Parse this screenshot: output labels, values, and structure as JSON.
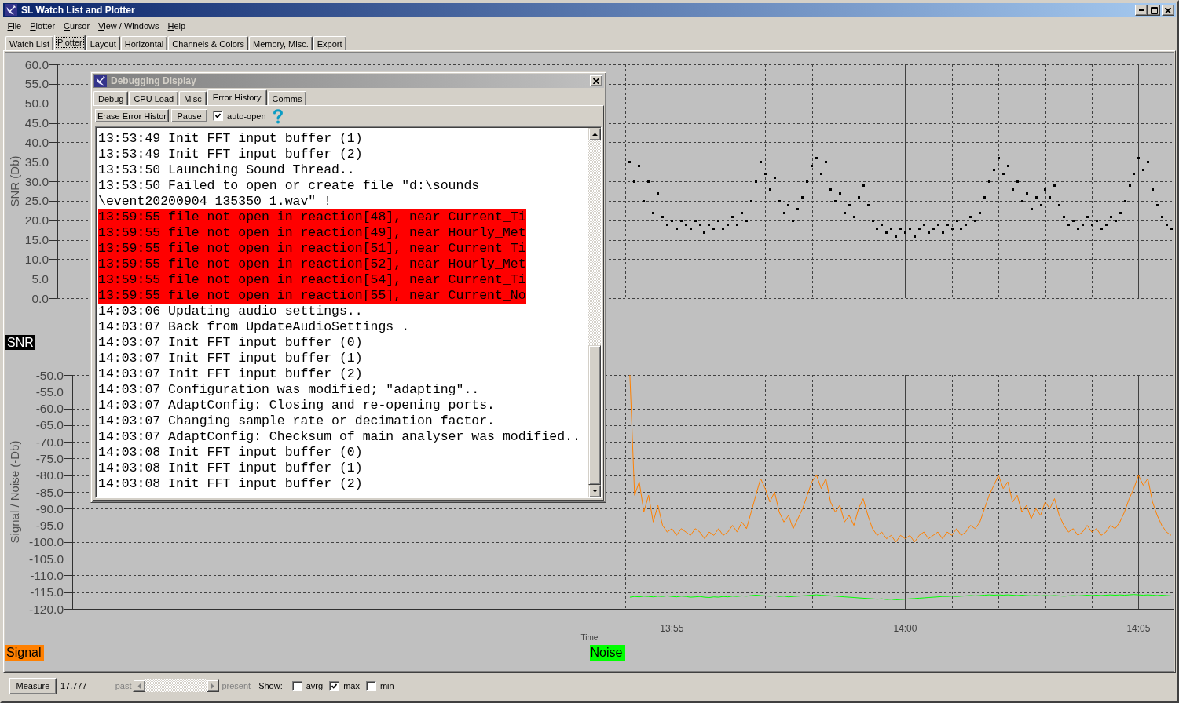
{
  "window": {
    "title": "SL Watch List and Plotter"
  },
  "menu": [
    "File",
    "Plotter",
    "Cursor",
    "View / Windows",
    "Help"
  ],
  "tabs": [
    {
      "label": "Watch List",
      "selected": false
    },
    {
      "label": "Plotter",
      "selected": true
    },
    {
      "label": "Layout",
      "selected": false
    },
    {
      "label": "Horizontal",
      "selected": false
    },
    {
      "label": "Channels & Colors",
      "selected": false
    },
    {
      "label": "Memory, Misc.",
      "selected": false
    },
    {
      "label": "Export",
      "selected": false
    }
  ],
  "plotter": {
    "upper_chart": {
      "chart_data": {
        "type": "scatter",
        "ylabel": "SNR (Db)",
        "grid": true,
        "categories": [
          null,
          null,
          null,
          null,
          null,
          null,
          null,
          null,
          null,
          null,
          null,
          null,
          null,
          null,
          null,
          null,
          null,
          null,
          null,
          null,
          null,
          null,
          null,
          null,
          null,
          null,
          null,
          null,
          null,
          null,
          null,
          null,
          null,
          null,
          null,
          null,
          null,
          null,
          null,
          null,
          null,
          null,
          null,
          null,
          null,
          null,
          null,
          null,
          null,
          null,
          null,
          null,
          null,
          null,
          null,
          null,
          null,
          null,
          null,
          null,
          null,
          null,
          null,
          null,
          null,
          null,
          null,
          null,
          null,
          null,
          null,
          null,
          null,
          null,
          null,
          null,
          null,
          null,
          null,
          null,
          null,
          null,
          null,
          null,
          null,
          null,
          null,
          null,
          null,
          null,
          null,
          null,
          null,
          null,
          null,
          null,
          null,
          null,
          null,
          null,
          null,
          null,
          null,
          null,
          null,
          null,
          null,
          null,
          null,
          null,
          null,
          null,
          null,
          null,
          null,
          null,
          null,
          null,
          null,
          null,
          null,
          null,
          null,
          null,
          null,
          null,
          null,
          null,
          null,
          null,
          null,
          null,
          null,
          null,
          null,
          null,
          null,
          null,
          null,
          null,
          null,
          null,
          null,
          null,
          null,
          null,
          null,
          null,
          null,
          null,
          null,
          null,
          null,
          null,
          null,
          null,
          null,
          null,
          null,
          null,
          null,
          null,
          null,
          null,
          null,
          null,
          null,
          null,
          null,
          null,
          null,
          null,
          null,
          null,
          null,
          null,
          null,
          null,
          null,
          null,
          null,
          null,
          null,
          null,
          null,
          null,
          null,
          null,
          null,
          null,
          null,
          null,
          null,
          null,
          null,
          null,
          null,
          null,
          null,
          null,
          null,
          null,
          null,
          null,
          null,
          null,
          null,
          null,
          null,
          null,
          null,
          null,
          null,
          null,
          null,
          null,
          null,
          null,
          null,
          null,
          null,
          null,
          null,
          null,
          null,
          null,
          null,
          null,
          null,
          null,
          null,
          null,
          null,
          null,
          null,
          null,
          null,
          null,
          null
        ],
        "ylim": [
          0,
          60
        ],
        "yticks": [
          {
            "value": 60,
            "label": "60.0"
          },
          {
            "value": 55,
            "label": "55.0"
          },
          {
            "value": 50,
            "label": "50.0"
          },
          {
            "value": 45,
            "label": "45.0"
          },
          {
            "value": 40,
            "label": "40.0"
          },
          {
            "value": 35,
            "label": "35.0"
          },
          {
            "value": 30,
            "label": "30.0"
          },
          {
            "value": 25,
            "label": "25.0"
          },
          {
            "value": 20,
            "label": "20.0"
          },
          {
            "value": 15,
            "label": "15.0"
          },
          {
            "value": 10,
            "label": "10.0"
          },
          {
            "value": 5,
            "label": "5.0"
          },
          {
            "value": 0,
            "label": "0.0"
          }
        ],
        "series": [
          {
            "name": "SNR",
            "color": "#000000",
            "values": [
              null,
              null,
              null,
              null,
              null,
              null,
              null,
              null,
              null,
              null,
              null,
              null,
              null,
              null,
              null,
              null,
              null,
              null,
              null,
              null,
              null,
              null,
              null,
              null,
              null,
              null,
              null,
              null,
              null,
              null,
              null,
              null,
              null,
              null,
              null,
              null,
              null,
              null,
              null,
              null,
              null,
              null,
              null,
              null,
              null,
              null,
              null,
              null,
              null,
              null,
              null,
              null,
              null,
              null,
              null,
              null,
              null,
              null,
              null,
              null,
              null,
              null,
              null,
              null,
              null,
              null,
              null,
              null,
              null,
              null,
              null,
              null,
              null,
              null,
              null,
              null,
              null,
              null,
              null,
              null,
              null,
              null,
              null,
              null,
              null,
              null,
              null,
              null,
              null,
              null,
              null,
              null,
              null,
              null,
              null,
              null,
              null,
              null,
              null,
              null,
              null,
              null,
              null,
              null,
              null,
              null,
              null,
              null,
              null,
              null,
              null,
              null,
              null,
              null,
              null,
              null,
              null,
              null,
              null,
              null,
              null,
              null,
              35,
              30,
              34,
              25,
              30,
              22,
              27,
              21,
              19,
              20,
              18,
              20,
              19,
              18,
              20,
              19,
              17,
              19,
              18,
              20,
              18,
              19,
              21,
              19,
              22,
              20,
              25,
              30,
              35,
              32,
              28,
              31,
              25,
              22,
              24,
              20,
              23,
              26,
              30,
              34,
              36,
              32,
              35,
              28,
              25,
              27,
              22,
              24,
              21,
              26,
              29,
              24,
              20,
              18,
              19,
              17,
              18,
              16,
              18,
              17,
              18,
              16,
              18,
              19,
              17,
              18,
              19,
              17,
              19,
              18,
              20,
              18,
              19,
              21,
              20,
              22,
              26,
              30,
              33,
              36,
              32,
              34,
              28,
              30,
              25,
              27,
              23,
              26,
              24,
              28,
              26,
              29,
              24,
              21,
              19,
              20,
              18,
              19,
              21,
              19,
              20,
              18,
              19,
              21,
              20,
              22,
              25,
              29,
              32,
              36,
              33,
              35,
              28,
              24,
              21,
              19,
              18
            ]
          }
        ]
      }
    },
    "lower_chart": {
      "chart_data": {
        "type": "line",
        "xlabel": "Time",
        "ylabel": "Signal / Noise (-Db)",
        "grid": true,
        "categories": [
          null,
          null,
          null,
          null,
          null,
          null,
          null,
          null,
          null,
          null,
          null,
          null,
          null,
          null,
          null,
          null,
          null,
          null,
          null,
          null,
          null,
          null,
          null,
          null,
          null,
          null,
          null,
          null,
          null,
          null,
          null,
          null,
          null,
          null,
          null,
          null,
          null,
          null,
          null,
          null,
          null,
          null,
          null,
          null,
          null,
          null,
          null,
          null,
          null,
          null,
          null,
          null,
          null,
          null,
          null,
          null,
          null,
          null,
          null,
          null,
          null,
          null,
          null,
          null,
          null,
          null,
          null,
          null,
          null,
          null,
          null,
          null,
          null,
          null,
          null,
          null,
          null,
          null,
          null,
          null,
          null,
          null,
          null,
          null,
          null,
          null,
          null,
          null,
          null,
          null,
          null,
          null,
          null,
          null,
          null,
          null,
          null,
          null,
          null,
          null,
          null,
          null,
          null,
          null,
          null,
          null,
          null,
          null,
          null,
          null,
          null,
          null,
          null,
          null,
          null,
          null,
          null,
          null,
          null,
          null,
          null,
          null,
          null,
          null,
          null,
          null,
          null,
          null,
          "13:55",
          null,
          null,
          null,
          null,
          null,
          null,
          null,
          null,
          null,
          null,
          null,
          null,
          null,
          null,
          null,
          null,
          null,
          null,
          null,
          null,
          null,
          null,
          null,
          null,
          null,
          null,
          null,
          null,
          null,
          null,
          null,
          null,
          null,
          null,
          null,
          null,
          null,
          null,
          null,
          null,
          null,
          null,
          null,
          null,
          null,
          null,
          null,
          null,
          null,
          "14:00",
          null,
          null,
          null,
          null,
          null,
          null,
          null,
          null,
          null,
          null,
          null,
          null,
          null,
          null,
          null,
          null,
          null,
          null,
          null,
          null,
          null,
          null,
          null,
          null,
          null,
          null,
          null,
          null,
          null,
          null,
          null,
          null,
          null,
          null,
          null,
          null,
          null,
          null,
          null,
          null,
          null,
          null,
          null,
          null,
          null,
          null,
          null,
          null,
          null,
          "14:05",
          null,
          null,
          null,
          null,
          null,
          null,
          null
        ],
        "ylim": [
          -120,
          -50
        ],
        "yticks": [
          {
            "value": -50,
            "label": "-50.0"
          },
          {
            "value": -55,
            "label": "-55.0"
          },
          {
            "value": -60,
            "label": "-60.0"
          },
          {
            "value": -65,
            "label": "-65.0"
          },
          {
            "value": -70,
            "label": "-70.0"
          },
          {
            "value": -75,
            "label": "-75.0"
          },
          {
            "value": -80,
            "label": "-80.0"
          },
          {
            "value": -85,
            "label": "-85.0"
          },
          {
            "value": -90,
            "label": "-90.0"
          },
          {
            "value": -95,
            "label": "-95.0"
          },
          {
            "value": -100,
            "label": "-100.0"
          },
          {
            "value": -105,
            "label": "-105.0"
          },
          {
            "value": -110,
            "label": "-110.0"
          },
          {
            "value": -115,
            "label": "-115.0"
          },
          {
            "value": -120,
            "label": "-120.0"
          }
        ],
        "series": [
          {
            "name": "Signal",
            "color": "#ff8000",
            "values": [
              null,
              null,
              null,
              null,
              null,
              null,
              null,
              null,
              null,
              null,
              null,
              null,
              null,
              null,
              null,
              null,
              null,
              null,
              null,
              null,
              null,
              null,
              null,
              null,
              null,
              null,
              null,
              null,
              null,
              null,
              null,
              null,
              null,
              null,
              null,
              null,
              null,
              null,
              null,
              null,
              null,
              null,
              null,
              null,
              null,
              null,
              null,
              null,
              null,
              null,
              null,
              null,
              null,
              null,
              null,
              null,
              null,
              null,
              null,
              null,
              null,
              null,
              null,
              null,
              null,
              null,
              null,
              null,
              null,
              null,
              null,
              null,
              null,
              null,
              null,
              null,
              null,
              null,
              null,
              null,
              null,
              null,
              null,
              null,
              null,
              null,
              null,
              null,
              null,
              null,
              null,
              null,
              null,
              null,
              null,
              null,
              null,
              null,
              null,
              null,
              null,
              null,
              null,
              null,
              null,
              null,
              null,
              null,
              null,
              null,
              null,
              null,
              null,
              null,
              null,
              null,
              null,
              null,
              null,
              -50,
              -86,
              -82,
              -91,
              -86,
              -94,
              -89,
              -95,
              -97,
              -96,
              -98,
              -96,
              -97,
              -98,
              -96,
              -97,
              -99,
              -97,
              -98,
              -96,
              -98,
              -97,
              -95,
              -97,
              -94,
              -96,
              -91,
              -86,
              -81,
              -84,
              -88,
              -85,
              -91,
              -94,
              -92,
              -96,
              -93,
              -90,
              -86,
              -82,
              -80,
              -84,
              -81,
              -88,
              -91,
              -89,
              -94,
              -92,
              -95,
              -90,
              -87,
              -92,
              -96,
              -98,
              -97,
              -99,
              -98,
              -100,
              -98,
              -99,
              -98,
              -100,
              -98,
              -97,
              -99,
              -98,
              -97,
              -99,
              -97,
              -98,
              -96,
              -98,
              -97,
              -95,
              -96,
              -94,
              -90,
              -86,
              -83,
              -80,
              -84,
              -82,
              -88,
              -86,
              -91,
              -89,
              -93,
              -90,
              -92,
              -88,
              -90,
              -87,
              -92,
              -95,
              -97,
              -96,
              -98,
              -97,
              -95,
              -97,
              -96,
              -98,
              -97,
              -95,
              -96,
              -94,
              -91,
              -87,
              -84,
              -80,
              -83,
              -81,
              -88,
              -92,
              -95,
              -97,
              -98
            ]
          },
          {
            "name": "Noise",
            "color": "#00ff00",
            "values": [
              null,
              null,
              null,
              null,
              null,
              null,
              null,
              null,
              null,
              null,
              null,
              null,
              null,
              null,
              null,
              null,
              null,
              null,
              null,
              null,
              null,
              null,
              null,
              null,
              null,
              null,
              null,
              null,
              null,
              null,
              null,
              null,
              null,
              null,
              null,
              null,
              null,
              null,
              null,
              null,
              null,
              null,
              null,
              null,
              null,
              null,
              null,
              null,
              null,
              null,
              null,
              null,
              null,
              null,
              null,
              null,
              null,
              null,
              null,
              null,
              null,
              null,
              null,
              null,
              null,
              null,
              null,
              null,
              null,
              null,
              null,
              null,
              null,
              null,
              null,
              null,
              null,
              null,
              null,
              null,
              null,
              null,
              null,
              null,
              null,
              null,
              null,
              null,
              null,
              null,
              null,
              null,
              null,
              null,
              null,
              null,
              null,
              null,
              null,
              null,
              null,
              null,
              null,
              null,
              null,
              null,
              null,
              null,
              null,
              null,
              null,
              null,
              null,
              null,
              null,
              null,
              null,
              null,
              null,
              -116.5,
              -116.3,
              -116.4,
              -116.2,
              -116.3,
              -116.4,
              -116.2,
              -116.3,
              -116.1,
              -116.3,
              -116.4,
              -116.2,
              -116.3,
              -116.5,
              -116.4,
              -116.3,
              -116.5,
              -116.6,
              -116.4,
              -116.5,
              -116.3,
              -116.4,
              -116.2,
              -116.3,
              -116.1,
              -116.2,
              -116.0,
              -115.9,
              -116.0,
              -116.1,
              -116.2,
              -116.1,
              -116.3,
              -116.2,
              -116.4,
              -116.3,
              -116.2,
              -116.1,
              -116.0,
              -115.9,
              -115.8,
              -115.9,
              -116.0,
              -116.1,
              -116.2,
              -116.3,
              -116.4,
              -116.5,
              -116.6,
              -116.7,
              -116.8,
              -116.9,
              -117.0,
              -117.1,
              -117.0,
              -117.2,
              -117.1,
              -117.3,
              -117.2,
              -117.1,
              -117.0,
              -116.9,
              -116.8,
              -116.7,
              -116.6,
              -116.5,
              -116.4,
              -116.3,
              -116.3,
              -116.2,
              -116.3,
              -116.2,
              -116.1,
              -116.0,
              -116.1,
              -116.0,
              -115.9,
              -115.8,
              -115.9,
              -115.8,
              -115.9,
              -115.8,
              -115.9,
              -116.0,
              -115.9,
              -116.0,
              -116.1,
              -116.0,
              -116.1,
              -116.0,
              -116.1,
              -116.0,
              -116.1,
              -116.2,
              -116.1,
              -116.0,
              -116.1,
              -116.0,
              -115.9,
              -116.0,
              -115.9,
              -116.0,
              -115.9,
              -115.8,
              -115.9,
              -115.8,
              -115.9,
              -115.8,
              -115.7,
              -115.8,
              -115.9,
              -115.8,
              -115.9,
              -116.0,
              -115.9,
              -116.0,
              -116.1
            ]
          }
        ]
      }
    }
  },
  "debug_window": {
    "title": "Debugging Display",
    "active": false,
    "tabs": [
      {
        "label": "Debug",
        "selected": false
      },
      {
        "label": "CPU Load",
        "selected": false
      },
      {
        "label": "Misc",
        "selected": false
      },
      {
        "label": "Error History",
        "selected": true
      },
      {
        "label": "Comms",
        "selected": false
      }
    ],
    "erase_button": "Erase Error Histor",
    "pause_button": "Pause",
    "auto_open": {
      "label": "auto-open",
      "checked": true
    },
    "log_lines": [
      {
        "text": "13:53:49 Init FFT input buffer (1)",
        "highlighted": false
      },
      {
        "text": "13:53:49 Init FFT input buffer (2)",
        "highlighted": false
      },
      {
        "text": "13:53:50 Launching Sound Thread..",
        "highlighted": false
      },
      {
        "text": "13:53:50 Failed to open or create file \"d:\\sounds",
        "highlighted": false
      },
      {
        "text": "\\event20200904_135350_1.wav\" !",
        "highlighted": false
      },
      {
        "text": "13:59:55 file not open in reaction[48], near Current_Ti",
        "highlighted": true
      },
      {
        "text": "13:59:55 file not open in reaction[49], near Hourly_Met",
        "highlighted": true
      },
      {
        "text": "13:59:55 file not open in reaction[51], near Current_Ti",
        "highlighted": true
      },
      {
        "text": "13:59:55 file not open in reaction[52], near Hourly_Met",
        "highlighted": true
      },
      {
        "text": "13:59:55 file not open in reaction[54], near Current_Ti",
        "highlighted": true
      },
      {
        "text": "13:59:55 file not open in reaction[55], near Current_No",
        "highlighted": true
      },
      {
        "text": "14:03:06 Updating audio settings..",
        "highlighted": false
      },
      {
        "text": "14:03:07 Back from UpdateAudioSettings .",
        "highlighted": false
      },
      {
        "text": "14:03:07 Init FFT input buffer (0)",
        "highlighted": false
      },
      {
        "text": "14:03:07 Init FFT input buffer (1)",
        "highlighted": false
      },
      {
        "text": "14:03:07 Init FFT input buffer (2)",
        "highlighted": false
      },
      {
        "text": "14:03:07 Configuration was modified; \"adapting\"..",
        "highlighted": false
      },
      {
        "text": "14:03:07 AdaptConfig: Closing and re-opening ports.",
        "highlighted": false
      },
      {
        "text": "14:03:07 Changing sample rate or decimation factor.",
        "highlighted": false
      },
      {
        "text": "14:03:07 AdaptConfig: Checksum of main analyser was modified..",
        "highlighted": false
      },
      {
        "text": "14:03:08 Init FFT input buffer (0)",
        "highlighted": false
      },
      {
        "text": "14:03:08 Init FFT input buffer (1)",
        "highlighted": false
      },
      {
        "text": "14:03:08 Init FFT input buffer (2)",
        "highlighted": false
      }
    ]
  },
  "bottom_bar": {
    "measure_button": "Measure",
    "measured_value": "17.777",
    "time_scroll": {
      "past_label": "past",
      "present_label": "present",
      "disabled": true
    },
    "show_label": "Show:",
    "show_options": [
      {
        "label": "avrg",
        "checked": false
      },
      {
        "label": "max",
        "checked": true
      },
      {
        "label": "min",
        "checked": false
      }
    ]
  }
}
